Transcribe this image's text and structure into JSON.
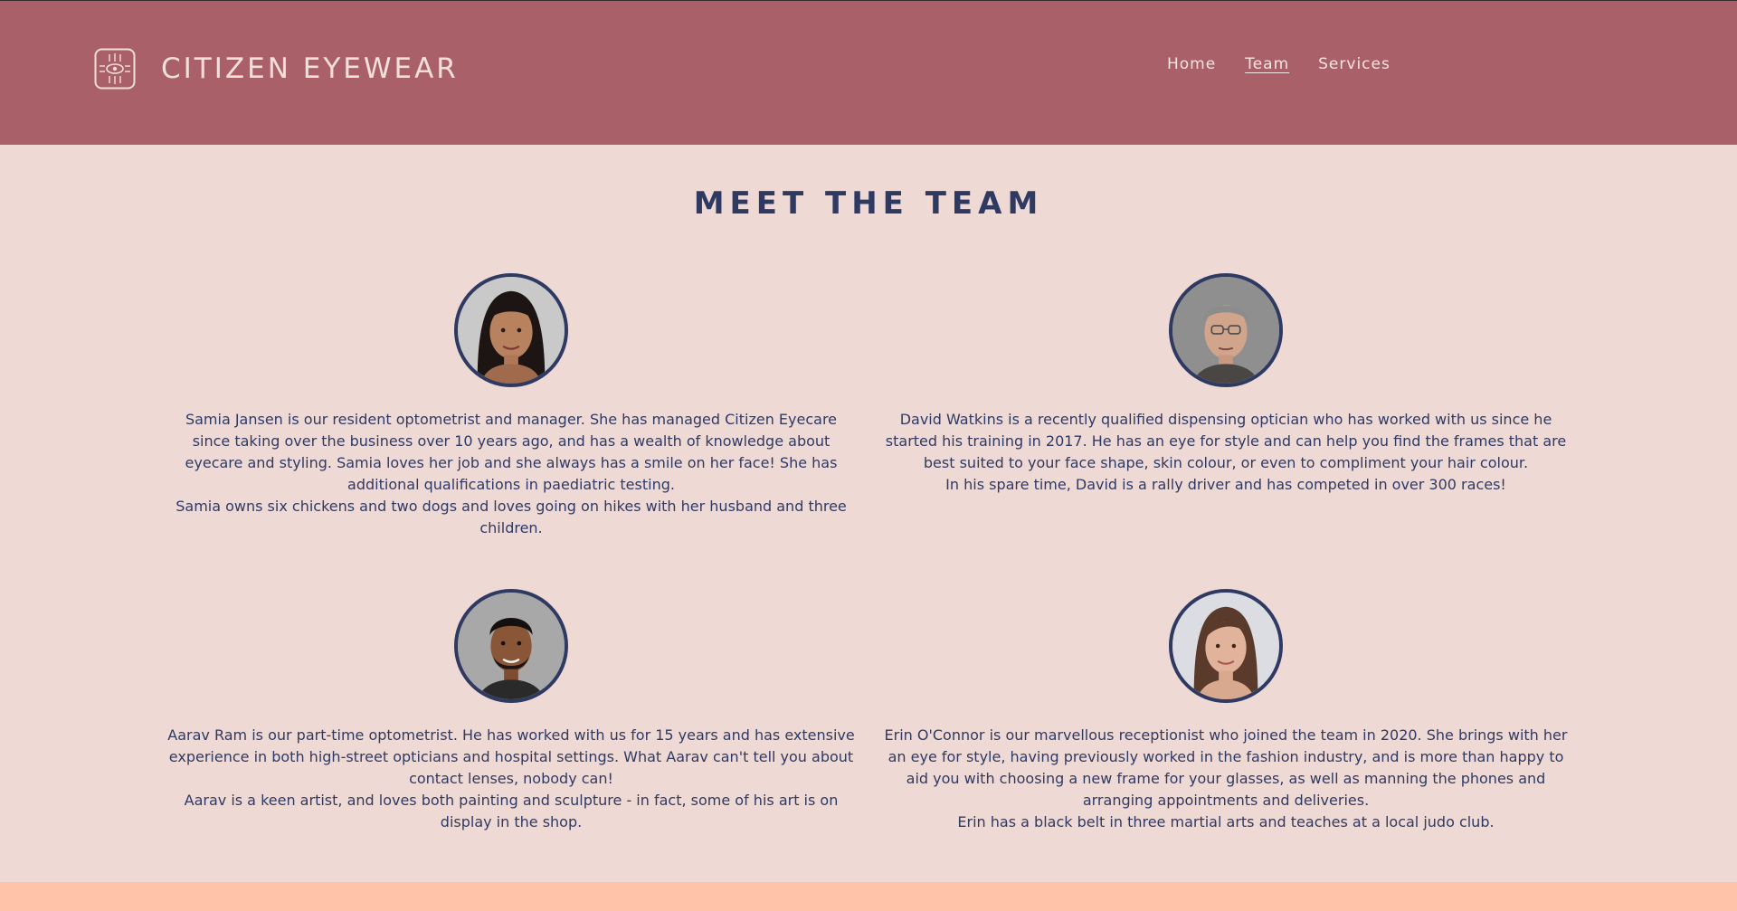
{
  "brand": {
    "name": "CITIZEN EYEWEAR",
    "logo_icon": "eye-emblem-icon"
  },
  "nav": {
    "items": [
      {
        "label": "Home",
        "active": false
      },
      {
        "label": "Team",
        "active": true
      },
      {
        "label": "Services",
        "active": false
      }
    ]
  },
  "section": {
    "title": "MEET THE TEAM"
  },
  "team": [
    {
      "p1": "Samia Jansen is our resident optometrist and manager. She has managed Citizen Eyecare since taking over the business over 10 years ago, and has a wealth of knowledge about eyecare and styling. Samia loves her job and she always has a smile on her face! She has additional qualifications in paediatric testing.",
      "p2": "Samia owns six chickens and two dogs and loves going on hikes with her husband and three children."
    },
    {
      "p1": "David Watkins is a recently qualified dispensing optician who has worked with us since he started his training in 2017. He has an eye for style and can help you find the frames that are best suited to your face shape, skin colour, or even to compliment your hair colour.",
      "p2": "In his spare time, David is a rally driver and has competed in over 300 races!"
    },
    {
      "p1": "Aarav Ram is our part-time optometrist. He has worked with us for 15 years and has extensive experience in both high-street opticians and hospital settings. What Aarav can't tell you about contact lenses, nobody can!",
      "p2": "Aarav is a keen artist, and loves both painting and sculpture - in fact, some of his art is on display in the shop."
    },
    {
      "p1": "Erin O'Connor is our marvellous receptionist who joined the team in 2020. She brings with her an eye for style, having previously worked in the fashion industry, and is more than happy to aid you with choosing a new frame for your glasses, as well as manning the phones and arranging appointments and deliveries.",
      "p2": "Erin has a black belt in three martial arts and teaches at a local judo club."
    }
  ],
  "colors": {
    "header_bg": "#aa6068",
    "page_bg": "#efd9d5",
    "accent_navy": "#2f3a63",
    "footer_strip": "#ffc3a9"
  }
}
